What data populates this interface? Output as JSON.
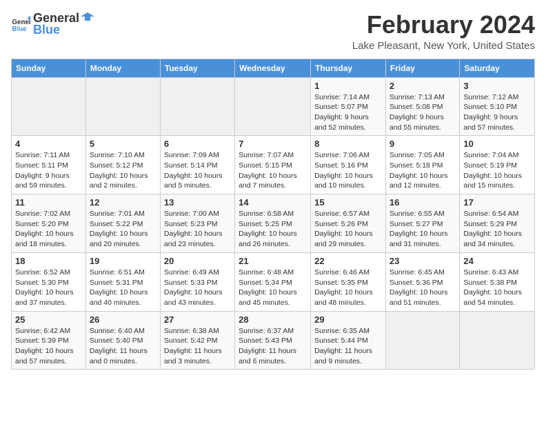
{
  "logo": {
    "text_general": "General",
    "text_blue": "Blue"
  },
  "title": "February 2024",
  "subtitle": "Lake Pleasant, New York, United States",
  "days_of_week": [
    "Sunday",
    "Monday",
    "Tuesday",
    "Wednesday",
    "Thursday",
    "Friday",
    "Saturday"
  ],
  "weeks": [
    [
      {
        "day": "",
        "info": ""
      },
      {
        "day": "",
        "info": ""
      },
      {
        "day": "",
        "info": ""
      },
      {
        "day": "",
        "info": ""
      },
      {
        "day": "1",
        "info": "Sunrise: 7:14 AM\nSunset: 5:07 PM\nDaylight: 9 hours and 52 minutes."
      },
      {
        "day": "2",
        "info": "Sunrise: 7:13 AM\nSunset: 5:08 PM\nDaylight: 9 hours and 55 minutes."
      },
      {
        "day": "3",
        "info": "Sunrise: 7:12 AM\nSunset: 5:10 PM\nDaylight: 9 hours and 57 minutes."
      }
    ],
    [
      {
        "day": "4",
        "info": "Sunrise: 7:11 AM\nSunset: 5:11 PM\nDaylight: 9 hours and 59 minutes."
      },
      {
        "day": "5",
        "info": "Sunrise: 7:10 AM\nSunset: 5:12 PM\nDaylight: 10 hours and 2 minutes."
      },
      {
        "day": "6",
        "info": "Sunrise: 7:09 AM\nSunset: 5:14 PM\nDaylight: 10 hours and 5 minutes."
      },
      {
        "day": "7",
        "info": "Sunrise: 7:07 AM\nSunset: 5:15 PM\nDaylight: 10 hours and 7 minutes."
      },
      {
        "day": "8",
        "info": "Sunrise: 7:06 AM\nSunset: 5:16 PM\nDaylight: 10 hours and 10 minutes."
      },
      {
        "day": "9",
        "info": "Sunrise: 7:05 AM\nSunset: 5:18 PM\nDaylight: 10 hours and 12 minutes."
      },
      {
        "day": "10",
        "info": "Sunrise: 7:04 AM\nSunset: 5:19 PM\nDaylight: 10 hours and 15 minutes."
      }
    ],
    [
      {
        "day": "11",
        "info": "Sunrise: 7:02 AM\nSunset: 5:20 PM\nDaylight: 10 hours and 18 minutes."
      },
      {
        "day": "12",
        "info": "Sunrise: 7:01 AM\nSunset: 5:22 PM\nDaylight: 10 hours and 20 minutes."
      },
      {
        "day": "13",
        "info": "Sunrise: 7:00 AM\nSunset: 5:23 PM\nDaylight: 10 hours and 23 minutes."
      },
      {
        "day": "14",
        "info": "Sunrise: 6:58 AM\nSunset: 5:25 PM\nDaylight: 10 hours and 26 minutes."
      },
      {
        "day": "15",
        "info": "Sunrise: 6:57 AM\nSunset: 5:26 PM\nDaylight: 10 hours and 29 minutes."
      },
      {
        "day": "16",
        "info": "Sunrise: 6:55 AM\nSunset: 5:27 PM\nDaylight: 10 hours and 31 minutes."
      },
      {
        "day": "17",
        "info": "Sunrise: 6:54 AM\nSunset: 5:29 PM\nDaylight: 10 hours and 34 minutes."
      }
    ],
    [
      {
        "day": "18",
        "info": "Sunrise: 6:52 AM\nSunset: 5:30 PM\nDaylight: 10 hours and 37 minutes."
      },
      {
        "day": "19",
        "info": "Sunrise: 6:51 AM\nSunset: 5:31 PM\nDaylight: 10 hours and 40 minutes."
      },
      {
        "day": "20",
        "info": "Sunrise: 6:49 AM\nSunset: 5:33 PM\nDaylight: 10 hours and 43 minutes."
      },
      {
        "day": "21",
        "info": "Sunrise: 6:48 AM\nSunset: 5:34 PM\nDaylight: 10 hours and 45 minutes."
      },
      {
        "day": "22",
        "info": "Sunrise: 6:46 AM\nSunset: 5:35 PM\nDaylight: 10 hours and 48 minutes."
      },
      {
        "day": "23",
        "info": "Sunrise: 6:45 AM\nSunset: 5:36 PM\nDaylight: 10 hours and 51 minutes."
      },
      {
        "day": "24",
        "info": "Sunrise: 6:43 AM\nSunset: 5:38 PM\nDaylight: 10 hours and 54 minutes."
      }
    ],
    [
      {
        "day": "25",
        "info": "Sunrise: 6:42 AM\nSunset: 5:39 PM\nDaylight: 10 hours and 57 minutes."
      },
      {
        "day": "26",
        "info": "Sunrise: 6:40 AM\nSunset: 5:40 PM\nDaylight: 11 hours and 0 minutes."
      },
      {
        "day": "27",
        "info": "Sunrise: 6:38 AM\nSunset: 5:42 PM\nDaylight: 11 hours and 3 minutes."
      },
      {
        "day": "28",
        "info": "Sunrise: 6:37 AM\nSunset: 5:43 PM\nDaylight: 11 hours and 6 minutes."
      },
      {
        "day": "29",
        "info": "Sunrise: 6:35 AM\nSunset: 5:44 PM\nDaylight: 11 hours and 9 minutes."
      },
      {
        "day": "",
        "info": ""
      },
      {
        "day": "",
        "info": ""
      }
    ]
  ]
}
